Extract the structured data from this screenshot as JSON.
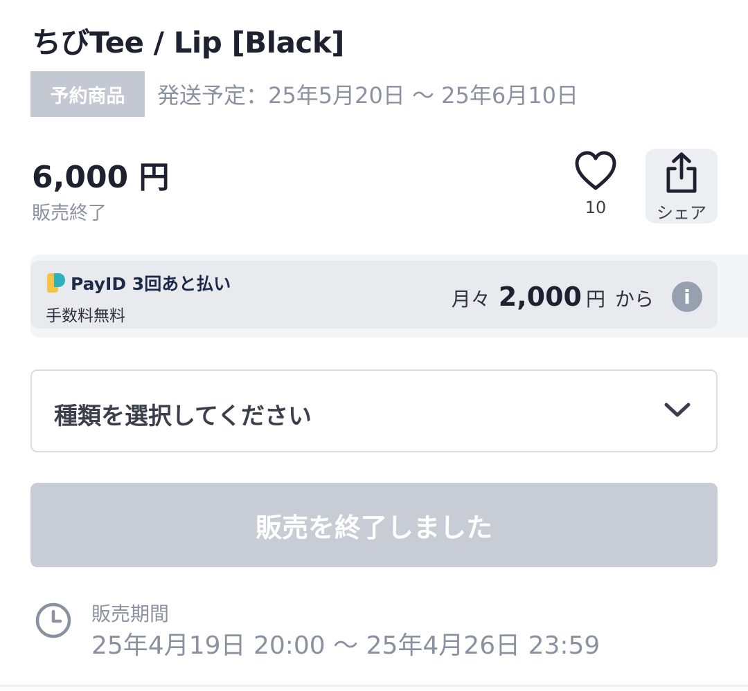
{
  "product": {
    "title": "ちびTee / Lip [Black]",
    "preorder_badge": "予約商品",
    "shipping_schedule": "発送予定：25年5月20日 〜 25年6月10日",
    "price": "6,000 円",
    "status": "販売終了"
  },
  "actions": {
    "like_count": "10",
    "share_label": "シェア"
  },
  "payid": {
    "logo_text": "PayID 3回あと払い",
    "fee_text": "手数料無料",
    "monthly_prefix": "月々",
    "monthly_amount": "2,000",
    "monthly_currency": "円",
    "monthly_suffix": "から",
    "info_icon": "i"
  },
  "variant_select": {
    "placeholder": "種類を選択してください"
  },
  "purchase_button": {
    "label": "販売を終了しました"
  },
  "sales_period": {
    "label": "販売期間",
    "value": "25年4月19日 20:00 〜 25年4月26日 23:59"
  },
  "colors": {
    "badge_bg": "#c3c8d2",
    "disabled_button": "#c7ccd5",
    "muted_text": "#8a91a0",
    "payid_logo_yellow": "#f5c542",
    "payid_logo_teal": "#2bb3c0"
  },
  "icons": [
    "heart-icon",
    "share-icon",
    "info-icon",
    "chevron-down-icon",
    "clock-icon",
    "payid-logo-icon"
  ]
}
